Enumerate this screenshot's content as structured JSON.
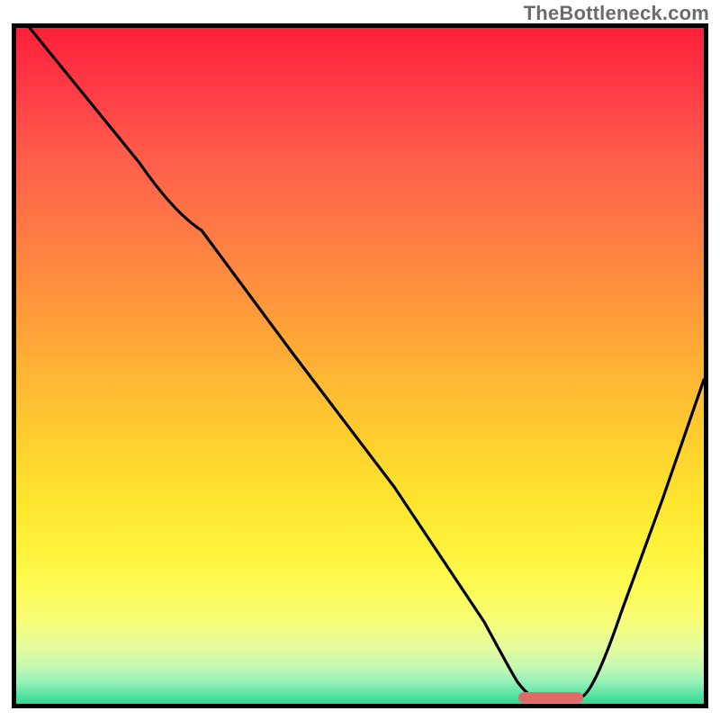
{
  "watermark": "TheBottleneck.com",
  "chart_data": {
    "type": "line",
    "title": "",
    "xlabel": "",
    "ylabel": "",
    "x_range": [
      0,
      100
    ],
    "y_range": [
      0,
      100
    ],
    "grid": false,
    "legend": false,
    "axes_visible": false,
    "background": "gradient-red-to-green-vertical",
    "description": "Bottleneck curve descending from top-left to a minimum near x≈77 then rising to the right; a short red marker segment indicates the optimal region at the valley bottom.",
    "series": [
      {
        "name": "bottleneck-curve",
        "type": "line",
        "x": [
          2,
          10,
          18,
          27,
          40,
          55,
          68,
          73,
          78,
          82,
          88,
          94,
          100
        ],
        "y": [
          100,
          90,
          80,
          70,
          52,
          32,
          12,
          3,
          0,
          0,
          13,
          30,
          48
        ]
      }
    ],
    "optimal_marker": {
      "x_start": 73,
      "x_end": 82,
      "y": 0,
      "color": "#e06a6a"
    }
  }
}
